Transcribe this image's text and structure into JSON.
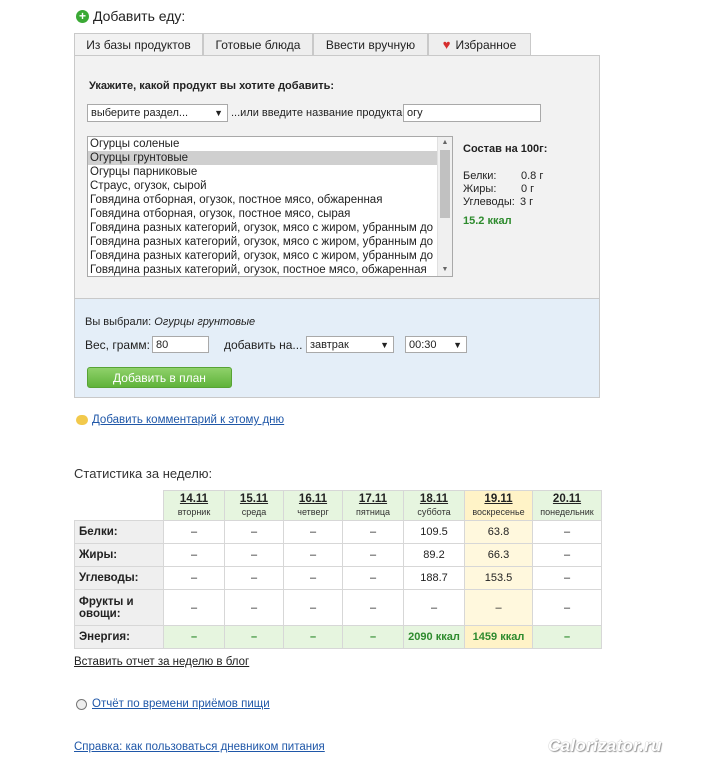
{
  "header": {
    "title": "Добавить еду:"
  },
  "tabs": [
    {
      "label": "Из базы продуктов"
    },
    {
      "label": "Готовые блюда"
    },
    {
      "label": "Ввести вручную"
    },
    {
      "label": "Избранное"
    }
  ],
  "search": {
    "prompt": "Укажите, какой продукт вы хотите добавить:",
    "category_select": "выберите раздел...",
    "or_label": "...или введите название продукта:",
    "query": "огу"
  },
  "results": [
    "Огурцы соленые",
    "Огурцы грунтовые",
    "Огурцы парниковые",
    "Страус, огузок, сырой",
    "Говядина отборная, огузок, постное мясо, обжаренная",
    "Говядина отборная, огузок, постное мясо, сырая",
    "Говядина разных категорий, огузок, мясо с жиром, убранным до",
    "Говядина разных категорий, огузок, мясо с жиром, убранным до",
    "Говядина разных категорий, огузок, мясо с жиром, убранным до",
    "Говядина разных категорий, огузок, постное мясо, обжаренная"
  ],
  "nutrition": {
    "title": "Состав на 100г:",
    "protein_label": "Белки:",
    "protein_value": "0.8 г",
    "fat_label": "Жиры:",
    "fat_value": "0 г",
    "carbs_label": "Углеводы:",
    "carbs_value": "3 г",
    "kcal": "15.2 ккал"
  },
  "selection": {
    "chosen_label": "Вы выбрали:",
    "chosen_value": "Огурцы грунтовые",
    "weight_label": "Вес, грамм:",
    "weight_value": "80",
    "add_to_label": "добавить на...",
    "meal_select": "завтрак",
    "time_select": "00:30",
    "add_button": "Добавить в план"
  },
  "links": {
    "comment": "Добавить комментарий к этому дню",
    "blog": "Вставить отчет за неделю в блог",
    "meal_time": "Отчёт по времени приёмов пищи",
    "help": "Справка: как пользоваться дневником питания"
  },
  "stats": {
    "title": "Статистика за неделю:",
    "days": [
      {
        "date": "14.11",
        "dow": "вторник"
      },
      {
        "date": "15.11",
        "dow": "среда"
      },
      {
        "date": "16.11",
        "dow": "четверг"
      },
      {
        "date": "17.11",
        "dow": "пятница"
      },
      {
        "date": "18.11",
        "dow": "суббота"
      },
      {
        "date": "19.11",
        "dow": "воскресенье"
      },
      {
        "date": "20.11",
        "dow": "понедельник"
      }
    ],
    "rows": [
      {
        "label": "Белки:",
        "values": [
          "–",
          "–",
          "–",
          "–",
          "109.5",
          "63.8",
          "–"
        ]
      },
      {
        "label": "Жиры:",
        "values": [
          "–",
          "–",
          "–",
          "–",
          "89.2",
          "66.3",
          "–"
        ]
      },
      {
        "label": "Углеводы:",
        "values": [
          "–",
          "–",
          "–",
          "–",
          "188.7",
          "153.5",
          "–"
        ]
      },
      {
        "label": "Фрукты и овощи:",
        "values": [
          "–",
          "–",
          "–",
          "–",
          "–",
          "–",
          "–"
        ]
      },
      {
        "label": "Энергия:",
        "values": [
          "–",
          "–",
          "–",
          "–",
          "2090 ккал",
          "1459 ккал",
          "–"
        ]
      }
    ]
  },
  "watermark": "Calorizator.ru",
  "colors": {
    "accent_green": "#5fb33a",
    "link_blue": "#1f57a8",
    "today_yellow": "#fff3c7",
    "header_green": "#e6f5df"
  }
}
